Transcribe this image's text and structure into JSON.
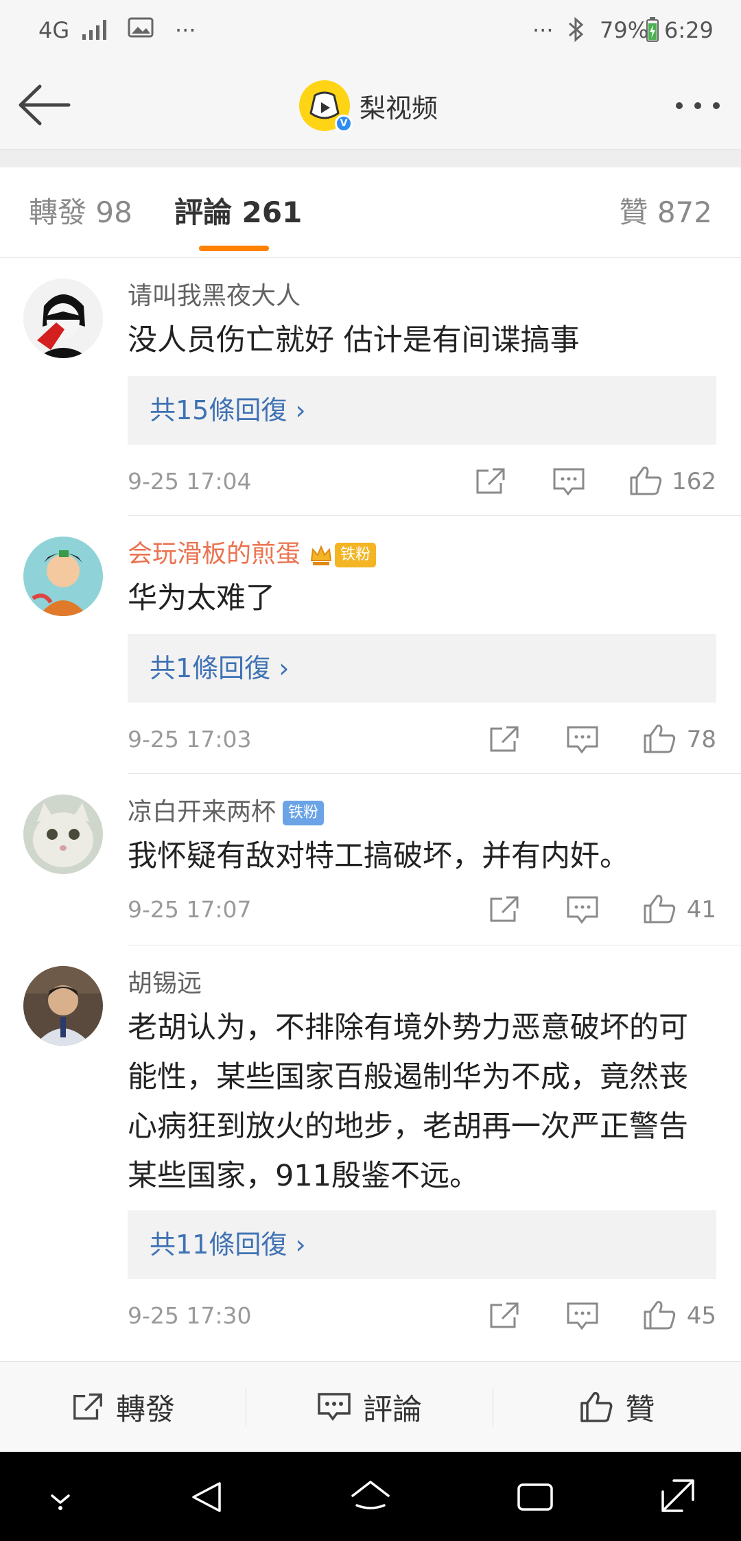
{
  "status_bar": {
    "network": "4G",
    "more": "···",
    "right_more": "···",
    "battery": "79%",
    "time": "6:29"
  },
  "header": {
    "title": "梨视频",
    "verified_badge": "V"
  },
  "tabs": [
    {
      "label": "轉發 98",
      "active": false
    },
    {
      "label": "評論 261",
      "active": true
    },
    {
      "label": "贊 872",
      "active": false
    }
  ],
  "comments": [
    {
      "user": "请叫我黑夜大人",
      "badge": "",
      "lines": [
        "没人员伤亡就好  估计是有间谍搞事"
      ],
      "replies": "共15條回復 ›",
      "date": "9-25 17:04",
      "likes": "162"
    },
    {
      "user": "会玩滑板的煎蛋",
      "badge": "铁粉",
      "lines": [
        "华为太难了"
      ],
      "replies": "共1條回復 ›",
      "date": "9-25 17:03",
      "likes": "78"
    },
    {
      "user": "凉白开来两杯",
      "badge": "铁粉",
      "lines": [
        "我怀疑有敌对特工搞破坏，并有内奸。"
      ],
      "replies": "",
      "date": "9-25 17:07",
      "likes": "41"
    },
    {
      "user": "胡锡远",
      "badge": "",
      "lines": [
        "老胡认为，不排除有境外势力恶意破坏的可",
        "能性，某些国家百般遏制华为不成，竟然丧",
        "心病狂到放火的地步，老胡再一次严正警告",
        "某些国家，911殷鉴不远。"
      ],
      "replies": "共11條回復 ›",
      "date": "9-25 17:30",
      "likes": "45"
    }
  ],
  "bottom_bar": {
    "repost": "轉發",
    "comment": "評論",
    "like": "贊"
  },
  "colors": {
    "accent": "#ff8200",
    "link": "#3f72b4",
    "vip_name": "#eb7350"
  }
}
